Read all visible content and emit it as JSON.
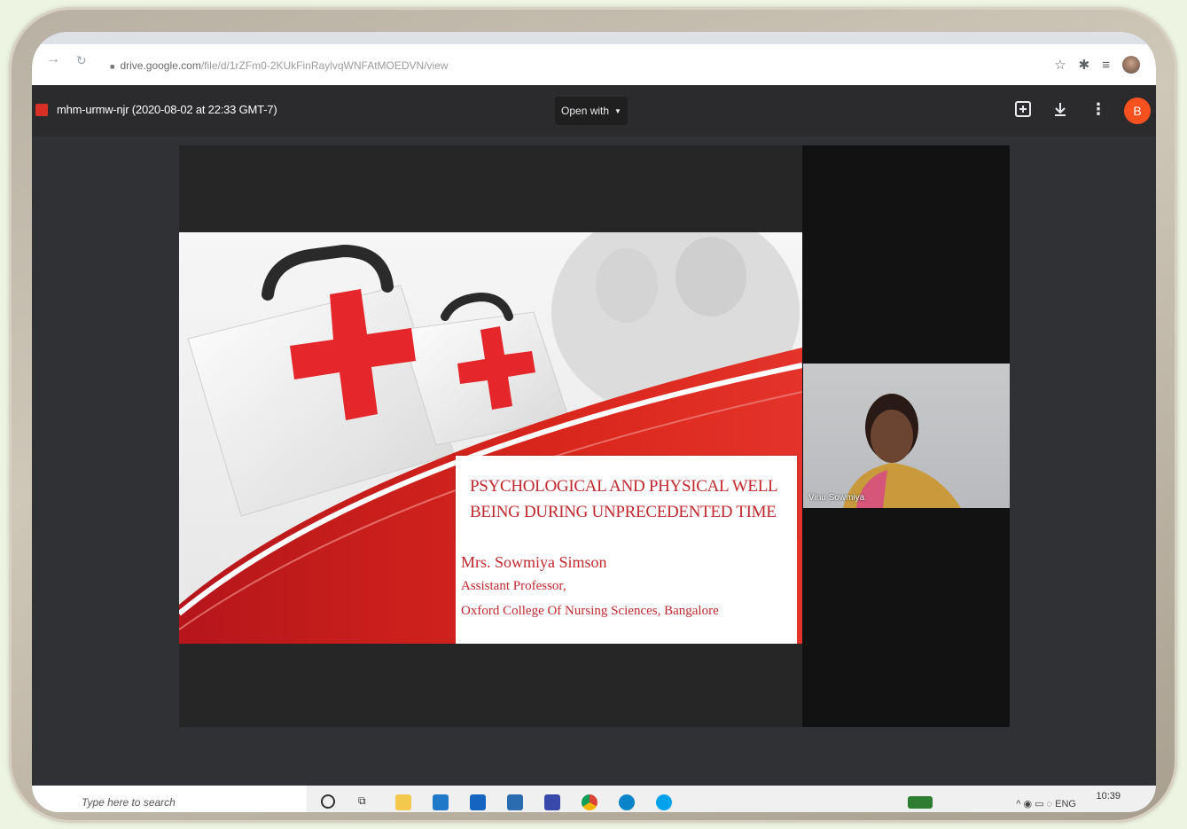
{
  "browser": {
    "url_host": "drive.google.com",
    "url_path": "/file/d/1rZFm0-2KUkFinRaylvqWNFAtMOEDVN/view"
  },
  "drive": {
    "file_title": "mhm-urmw-njr (2020-08-02 at 22:33 GMT-7)",
    "open_with_label": "Open with",
    "avatar_letter": "B"
  },
  "slide": {
    "title": "PSYCHOLOGICAL AND PHYSICAL WELL BEING DURING UNPRECEDENTED  TIME",
    "presenter": "Mrs. Sowmiya Simson",
    "role": "Assistant Professor,",
    "affiliation": "Oxford College Of Nursing Sciences, Bangalore"
  },
  "participant": {
    "name": "Vinu Sowmiya"
  },
  "taskbar": {
    "search_placeholder": "Type here to search",
    "language": "ENG",
    "time": "10:39"
  },
  "colors": {
    "accent_red": "#d9261c",
    "drive_header": "#2b2b2d",
    "avatar": "#f4511e"
  }
}
